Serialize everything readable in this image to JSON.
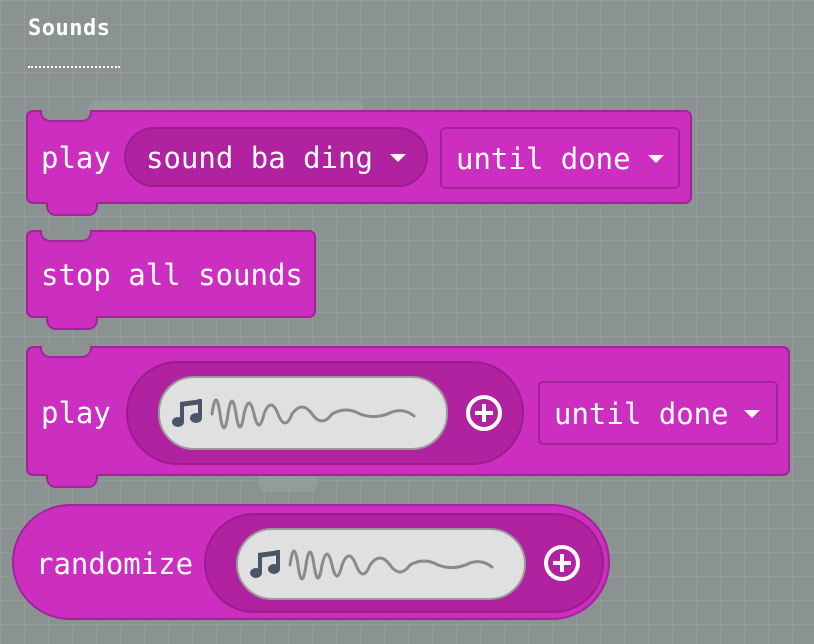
{
  "category": {
    "title": "Sounds"
  },
  "blocks": {
    "play_sound": {
      "verb": "play",
      "sound": "sound ba ding",
      "mode": "until done"
    },
    "stop_all": {
      "label": "stop all sounds"
    },
    "play_expression": {
      "verb": "play",
      "mode": "until done"
    },
    "randomize": {
      "label": "randomize"
    }
  },
  "colors": {
    "block": "#cc2ec0",
    "block_border": "#a3239a",
    "input_slot": "#b0229f",
    "wave_field": "#e0e0e0",
    "wave_stroke": "#8a8a8a",
    "note_icon": "#4a5568",
    "workspace": "#8a9392"
  },
  "icons": {
    "note": "music-note-icon",
    "wave": "sound-wave-icon",
    "plus": "plus-circle-icon",
    "caret": "caret-down-icon"
  }
}
